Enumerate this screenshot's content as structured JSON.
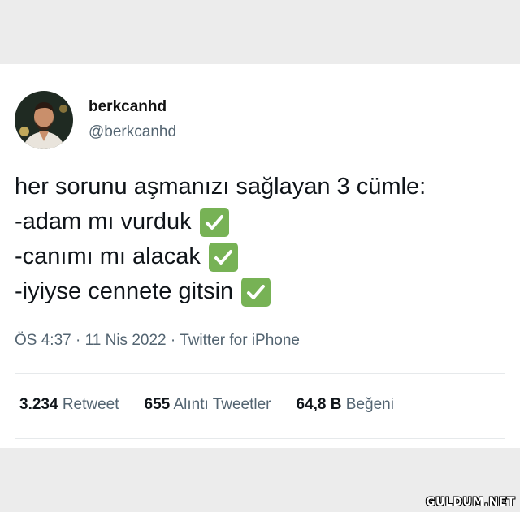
{
  "tweet": {
    "display_name": "berkcanhd",
    "handle": "@berkcanhd",
    "lines": [
      "her sorunu aşmanızı sağlayan 3 cümle:",
      "-adam mı vurduk",
      "-canımı mı alacak",
      "-iyiyse cennete gitsin"
    ],
    "check_icon": "check-mark-button-emoji",
    "time": "ÖS 4:37",
    "date": "11 Nis 2022",
    "source": "Twitter for iPhone",
    "separator": "·"
  },
  "stats": {
    "retweet_count": "3.234",
    "retweet_label": "Retweet",
    "quote_count": "655",
    "quote_label": "Alıntı Tweetler",
    "like_count": "64,8 B",
    "like_label": "Beğeni"
  },
  "watermark": "GULDUM.NET",
  "colors": {
    "background": "#ececec",
    "card": "#ffffff",
    "text": "#0f1419",
    "secondary_text": "#536471",
    "check_green": "#77b255"
  }
}
